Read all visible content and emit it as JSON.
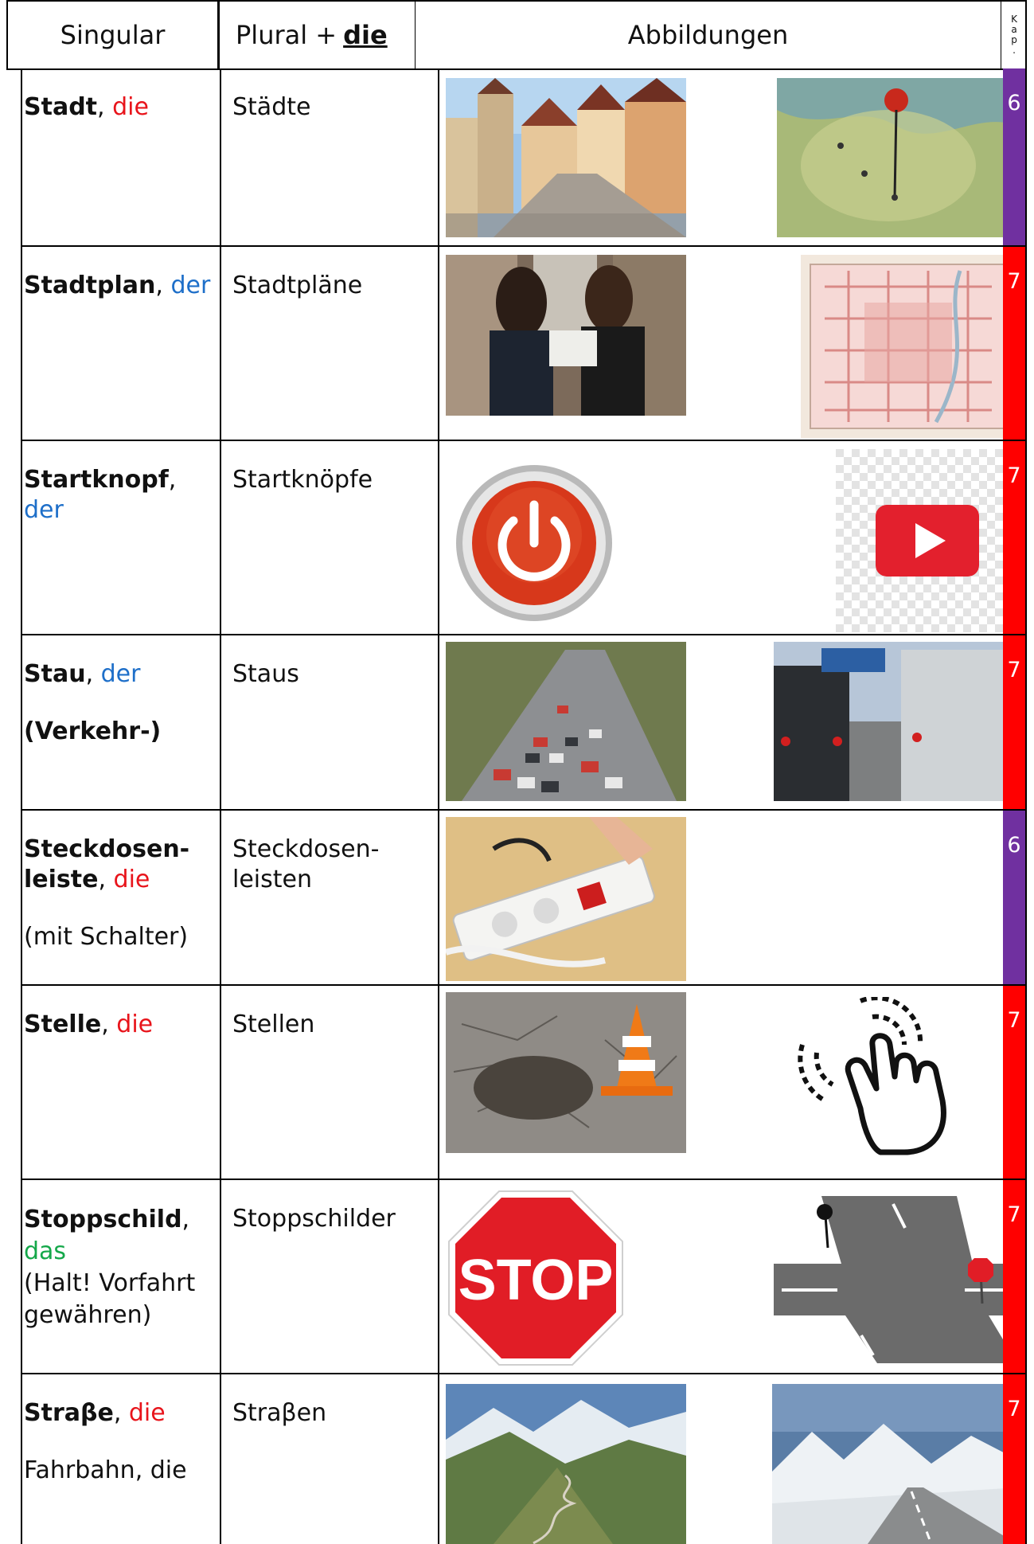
{
  "header": {
    "singular": "Singular",
    "plural": "Plural +",
    "plural_article": "die",
    "images": "Abbildungen",
    "chapter": [
      "K",
      "a",
      "p",
      "."
    ]
  },
  "colors": {
    "feminine": "#e8141b",
    "masculine": "#1e6fc9",
    "neuter": "#15a84a",
    "chapter6": "#7030a0",
    "chapter7": "#ff0000"
  },
  "rows": [
    {
      "word": "Stadt",
      "sep": ", ",
      "article": "die",
      "extra": [],
      "plural": "Städte",
      "chapter": "6",
      "images": [
        "old-town-street-photo",
        "map-pin-bonn-photo"
      ]
    },
    {
      "word": "Stadtplan",
      "sep": ", ",
      "article": "der",
      "extra": [],
      "plural": "Stadtpläne",
      "chapter": "7",
      "images": [
        "women-reading-map-photo",
        "city-map-munich-image"
      ]
    },
    {
      "word": "Startknopf",
      "sep": ", ",
      "article": "der",
      "extra": [],
      "plural": "Startknöpfe",
      "chapter": "7",
      "images": [
        "red-power-button-icon",
        "play-button-icon"
      ]
    },
    {
      "word": "Stau",
      "sep": ", ",
      "article": "der",
      "extra": [
        "(Verkehr-)"
      ],
      "plural": "Staus",
      "chapter": "7",
      "images": [
        "traffic-jam-aerial-photo",
        "traffic-jam-road-photo"
      ]
    },
    {
      "word_lines": [
        "Steckdosen-",
        "leiste"
      ],
      "sep": ", ",
      "article": "die",
      "extra": [
        "(mit Schalter)"
      ],
      "plural_lines": [
        "Steckdosen-",
        "leisten"
      ],
      "chapter": "6",
      "images": [
        "power-strip-switch-photo"
      ]
    },
    {
      "word": "Stelle",
      "sep": ", ",
      "article": "die",
      "extra": [],
      "plural": "Stellen",
      "chapter": "7",
      "images": [
        "pothole-traffic-cone-photo",
        "tap-hand-icon"
      ]
    },
    {
      "word": "Stoppschild",
      "sep": ",",
      "article": "das",
      "extra": [
        "(Halt! Vorfahrt",
        "gewähren)"
      ],
      "plural": "Stoppschilder",
      "chapter": "7",
      "images": [
        "stop-sign-image",
        "intersection-stop-sign-illustration"
      ],
      "stop_text": "STOP"
    },
    {
      "word": "Straβe",
      "sep": ", ",
      "article": "die",
      "extra": [
        "Fahrbahn, die"
      ],
      "plural": "Straβen",
      "chapter": "7",
      "images": [
        "mountain-pass-road-photo",
        "snowy-mountain-road-photo"
      ]
    }
  ]
}
